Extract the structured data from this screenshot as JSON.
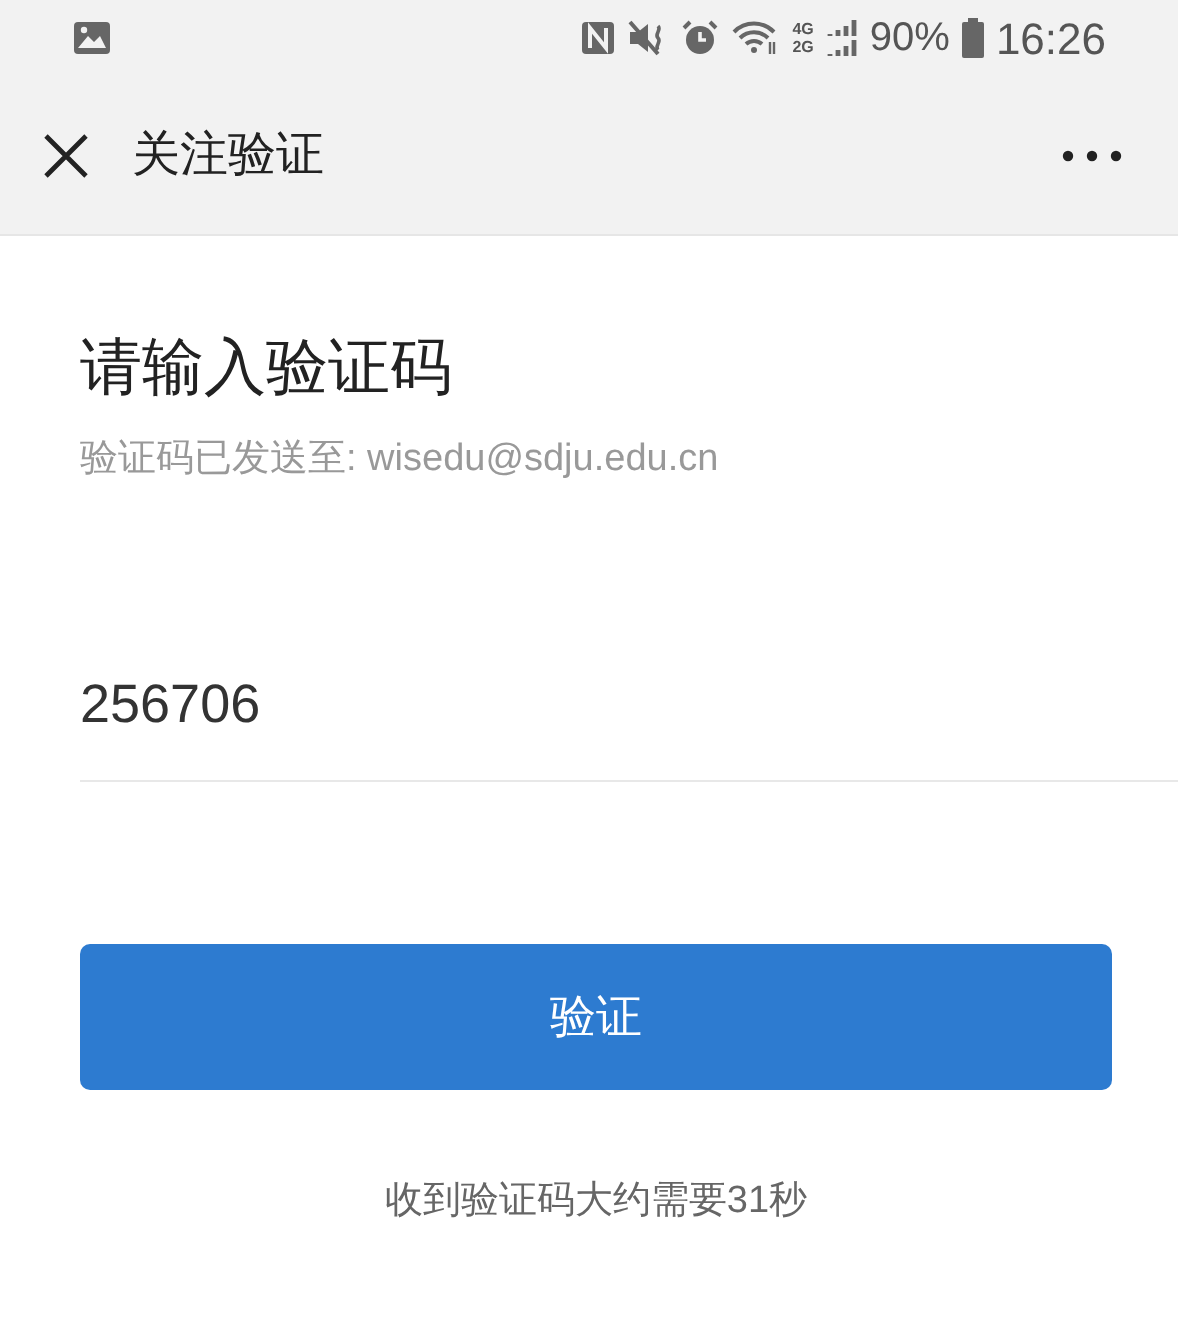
{
  "status_bar": {
    "network_top": "4G",
    "network_bottom": "2G",
    "battery": "90%",
    "time": "16:26"
  },
  "header": {
    "title": "关注验证"
  },
  "heading": "请输入验证码",
  "hint": "验证码已发送至: wisedu@sdju.edu.cn",
  "code_field": {
    "value": "256706"
  },
  "verify_button": "验证",
  "footer": "收到验证码大约需要31秒"
}
